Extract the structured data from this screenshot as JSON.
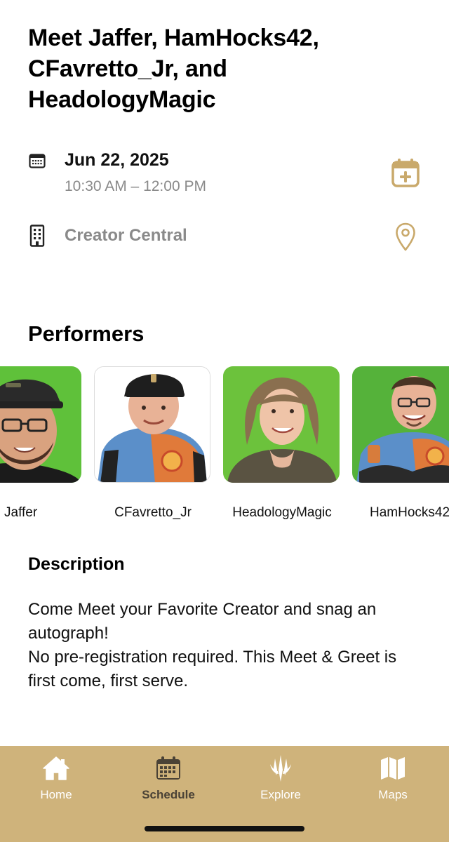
{
  "event": {
    "title": "Meet Jaffer, HamHocks42, CFavretto_Jr, and HeadologyMagic",
    "date": "Jun 22, 2025",
    "time": "10:30 AM – 12:00 PM",
    "venue": "Creator Central"
  },
  "icons": {
    "calendar": "calendar-icon",
    "building": "building-icon",
    "add_to_calendar": "calendar-plus-icon",
    "location": "map-pin-icon"
  },
  "performers_section": {
    "title": "Performers",
    "items": [
      {
        "name": "Jaffer",
        "photo_bg": "#5fc13a"
      },
      {
        "name": "CFavretto_Jr",
        "photo_bg": "#ffffff"
      },
      {
        "name": "HeadologyMagic",
        "photo_bg": "#6cc23c"
      },
      {
        "name": "HamHocks42",
        "photo_bg": "#55b23a"
      }
    ]
  },
  "description": {
    "title": "Description",
    "lines": [
      "Come Meet your Favorite Creator and snag an autograph!",
      "No pre-registration required. This Meet & Greet is first come, first serve."
    ]
  },
  "tab_bar": {
    "tabs": [
      {
        "label": "Home",
        "icon": "home-icon",
        "active": false
      },
      {
        "label": "Schedule",
        "icon": "calendar-icon",
        "active": true
      },
      {
        "label": "Explore",
        "icon": "planeswalker-icon",
        "active": false
      },
      {
        "label": "Maps",
        "icon": "map-icon",
        "active": false
      }
    ]
  },
  "colors": {
    "accent_gold": "#c9a96b",
    "tab_bar_bg": "#cfb37b",
    "muted_text": "#8a8a8a",
    "active_tab_text": "#4a4236"
  }
}
